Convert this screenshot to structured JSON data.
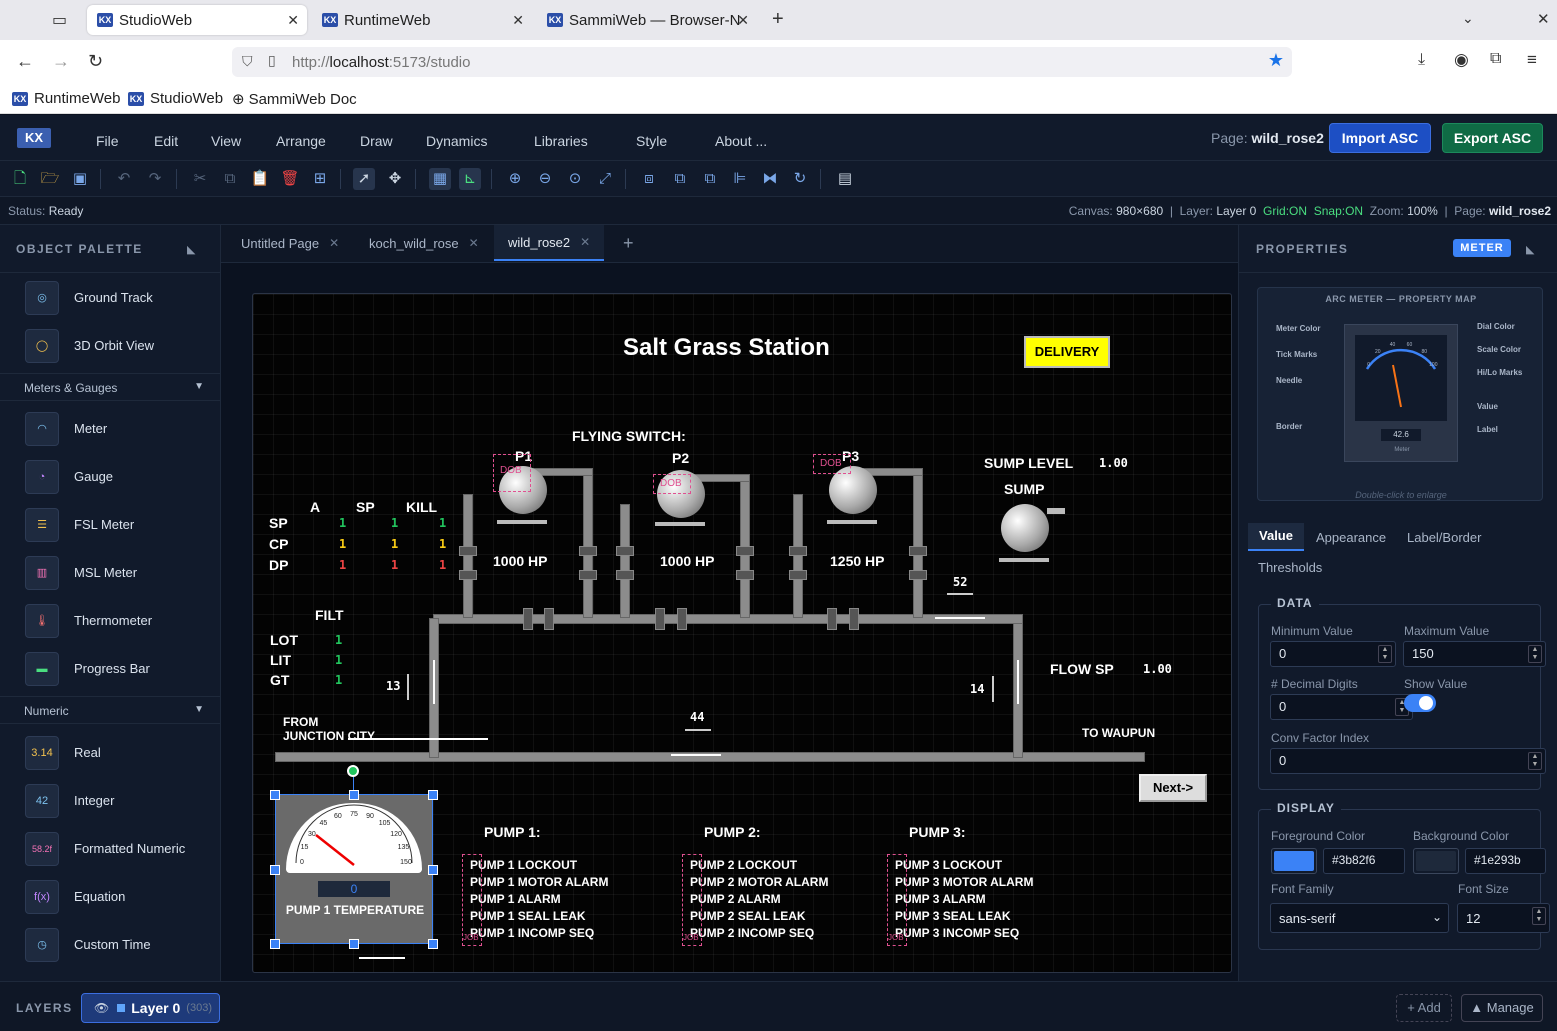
{
  "browser": {
    "tabs": [
      {
        "label": "StudioWeb"
      },
      {
        "label": "RuntimeWeb"
      },
      {
        "label": "SammiWeb — Browser-N"
      }
    ],
    "url_prefix": "http://",
    "url_host": "localhost",
    "url_rest": ":5173/studio",
    "bookmarks": [
      "RuntimeWeb",
      "StudioWeb",
      "SammiWeb Doc"
    ]
  },
  "app": {
    "logo": "KX",
    "menu": [
      "File",
      "Edit",
      "View",
      "Arrange",
      "Draw",
      "Dynamics",
      "Libraries",
      "Style",
      "About ..."
    ],
    "page_label": "Page:",
    "page_name": "wild_rose2",
    "import_label": "Import ASC",
    "export_label": "Export ASC",
    "accent": "#3b82f6"
  },
  "status": {
    "label": "Status:",
    "value": "Ready",
    "canvas_label": "Canvas:",
    "canvas_value": "980×680",
    "layer_label": "Layer:",
    "layer_value": "Layer 0",
    "grid": "Grid:ON",
    "snap": "Snap:ON",
    "zoom_label": "Zoom:",
    "zoom_value": "100%",
    "page_label": "Page:",
    "page_value": "wild_rose2"
  },
  "palette": {
    "title": "OBJECT PALETTE",
    "items_top": [
      "Ground Track",
      "3D Orbit View"
    ],
    "section_meters": "Meters & Gauges",
    "meters": [
      "Meter",
      "Gauge",
      "FSL Meter",
      "MSL Meter",
      "Thermometer",
      "Progress Bar"
    ],
    "section_numeric": "Numeric",
    "numeric": [
      "Real",
      "Integer",
      "Formatted Numeric",
      "Equation",
      "Custom Time"
    ],
    "numeric_icons": [
      "3.14",
      "42",
      "58.2f",
      "f(x)",
      ""
    ]
  },
  "doctabs": [
    "Untitled Page",
    "koch_wild_rose",
    "wild_rose2"
  ],
  "canvas": {
    "title": "Salt Grass Station",
    "delivery": "DELIVERY",
    "flying_switch": "FLYING SWITCH:",
    "pumps": [
      "P1",
      "P2",
      "P3"
    ],
    "hp": [
      "1000 HP",
      "1000 HP",
      "1250 HP"
    ],
    "sump_level_label": "SUMP LEVEL",
    "sump_level_value": "1.00",
    "sump": "SUMP",
    "table_headers": [
      "A",
      "SP",
      "KILL"
    ],
    "table_rows": [
      {
        "label": "SP",
        "values": [
          "1",
          "1",
          "1"
        ],
        "color": "#22c55e"
      },
      {
        "label": "CP",
        "values": [
          "1",
          "1",
          "1"
        ],
        "color": "#facc15"
      },
      {
        "label": "DP",
        "values": [
          "1",
          "1",
          "1"
        ],
        "color": "#ef4444"
      }
    ],
    "filt": "FILT",
    "filt_rows": [
      {
        "label": "LOT",
        "value": "1"
      },
      {
        "label": "LIT",
        "value": "1"
      },
      {
        "label": "GT",
        "value": "1"
      }
    ],
    "readings": {
      "r52": "52",
      "r13": "13",
      "r14": "14",
      "r44": "44"
    },
    "flow_sp_label": "FLOW SP",
    "flow_sp_value": "1.00",
    "from_label": "FROM",
    "from_city": "JUNCTION CITY",
    "to_label": "TO WAUPUN",
    "next": "Next->",
    "dob": "DOB",
    "job": "JOB",
    "meter_value": "0",
    "meter_label": "PUMP 1 TEMPERATURE",
    "meter_ticks": [
      "0",
      "15",
      "30",
      "45",
      "60",
      "75",
      "90",
      "105",
      "120",
      "135",
      "150"
    ],
    "pump_sections": [
      {
        "title": "PUMP 1:",
        "alarms": [
          "PUMP 1 LOCKOUT",
          "PUMP 1 MOTOR ALARM",
          "PUMP 1 ALARM",
          "PUMP 1 SEAL LEAK",
          "PUMP 1 INCOMP SEQ"
        ]
      },
      {
        "title": "PUMP 2:",
        "alarms": [
          "PUMP 2 LOCKOUT",
          "PUMP 2 MOTOR ALARM",
          "PUMP 2 ALARM",
          "PUMP 2 SEAL LEAK",
          "PUMP 2 INCOMP SEQ"
        ]
      },
      {
        "title": "PUMP 3:",
        "alarms": [
          "PUMP 3 LOCKOUT",
          "PUMP 3 MOTOR ALARM",
          "PUMP 3 ALARM",
          "PUMP 3 SEAL LEAK",
          "PUMP 3 INCOMP SEQ"
        ]
      }
    ]
  },
  "props": {
    "title": "PROPERTIES",
    "badge": "METER",
    "map_title": "ARC METER — PROPERTY MAP",
    "map_left": [
      "Meter Color",
      "Tick Marks",
      "Needle",
      "Border"
    ],
    "map_right": [
      "Dial Color",
      "Scale Color",
      "Hi/Lo Marks",
      "Value",
      "Label"
    ],
    "map_value": "42.6",
    "map_meter": "Meter",
    "map_ticks": [
      "0",
      "20",
      "40",
      "60",
      "80",
      "100"
    ],
    "map_hint": "Double-click to enlarge",
    "tabs": [
      "Value",
      "Appearance",
      "Label/Border",
      "Thresholds"
    ],
    "data_title": "DATA",
    "min_label": "Minimum Value",
    "min_value": "0",
    "max_label": "Maximum Value",
    "max_value": "150",
    "decimal_label": "# Decimal Digits",
    "decimal_value": "0",
    "show_label": "Show Value",
    "show_value_on": true,
    "conv_label": "Conv Factor Index",
    "conv_value": "0",
    "display_title": "DISPLAY",
    "fg_label": "Foreground Color",
    "fg_value": "#3b82f6",
    "bg_label": "Background Color",
    "bg_value": "#1e293b",
    "font_label": "Font Family",
    "font_value": "sans-serif",
    "size_label": "Font Size",
    "size_value": "12"
  },
  "layers": {
    "title": "LAYERS",
    "layer": "Layer 0",
    "count": "303",
    "add": "+ Add",
    "manage": "▲ Manage"
  }
}
